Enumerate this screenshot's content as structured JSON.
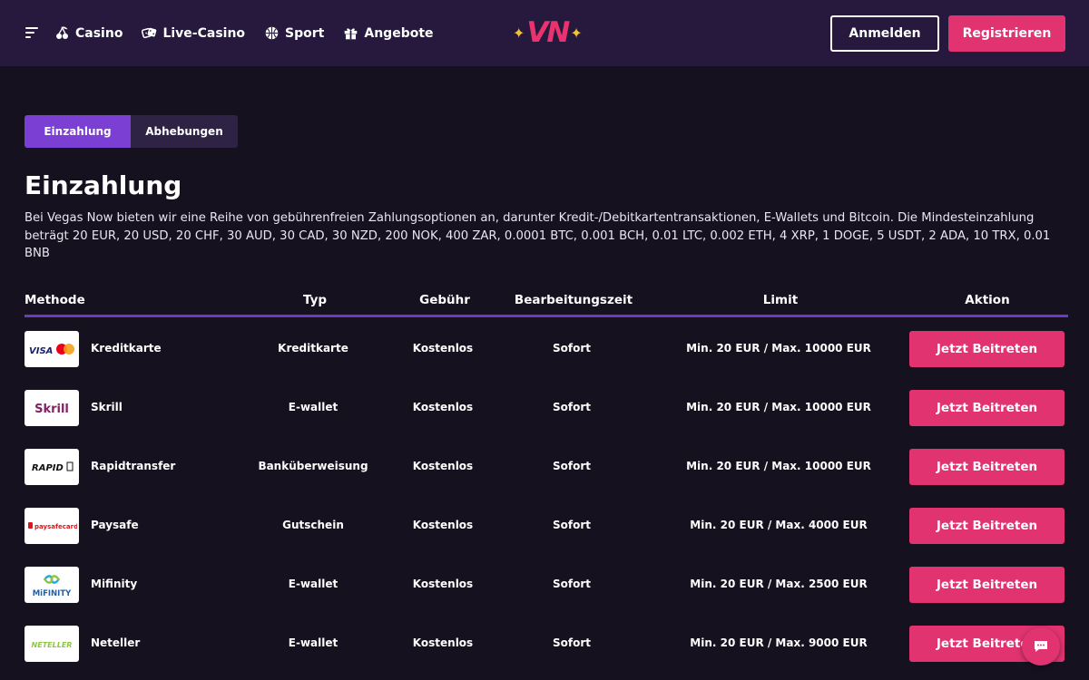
{
  "header": {
    "nav": [
      {
        "label": "Casino",
        "icon": "cherry-icon"
      },
      {
        "label": "Live-Casino",
        "icon": "dice-icon"
      },
      {
        "label": "Sport",
        "icon": "ball-icon"
      },
      {
        "label": "Angebote",
        "icon": "gift-icon"
      }
    ],
    "logo_text": "VN",
    "login_label": "Anmelden",
    "register_label": "Registrieren"
  },
  "tabs": [
    {
      "label": "Einzahlung",
      "active": true
    },
    {
      "label": "Abhebungen",
      "active": false
    }
  ],
  "section": {
    "title": "Einzahlung",
    "description": "Bei Vegas Now bieten wir eine Reihe von gebührenfreien Zahlungsoptionen an, darunter Kredit-/Debitkartentransaktionen, E-Wallets und Bitcoin. Die Mindesteinzahlung beträgt 20 EUR, 20 USD, 20 CHF, 30 AUD, 30 CAD, 30 NZD, 200 NOK, 400 ZAR, 0.0001 BTC, 0.001 BCH, 0.01 LTC, 0.002 ETH, 4 XRP, 1 DOGE, 5 USDT, 2 ADA, 10 TRX, 0.01 BNB"
  },
  "table": {
    "headers": {
      "method": "Methode",
      "type": "Typ",
      "fee": "Gebühr",
      "time": "Bearbeitungszeit",
      "limit": "Limit",
      "action": "Aktion"
    },
    "rows": [
      {
        "name": "Kreditkarte",
        "type": "Kreditkarte",
        "fee": "Kostenlos",
        "time": "Sofort",
        "limit": "Min. 20 EUR / Max. 10000 EUR",
        "action": "Jetzt Beitreten",
        "logo": "visa-mastercard-logo",
        "logo_text": "VISA"
      },
      {
        "name": "Skrill",
        "type": "E-wallet",
        "fee": "Kostenlos",
        "time": "Sofort",
        "limit": "Min. 20 EUR / Max. 10000 EUR",
        "action": "Jetzt Beitreten",
        "logo": "skrill-logo",
        "logo_text": "Skrill"
      },
      {
        "name": "Rapidtransfer",
        "type": "Banküberweisung",
        "fee": "Kostenlos",
        "time": "Sofort",
        "limit": "Min. 20 EUR / Max. 10000 EUR",
        "action": "Jetzt Beitreten",
        "logo": "rapid-logo",
        "logo_text": "RAPID"
      },
      {
        "name": "Paysafe",
        "type": "Gutschein",
        "fee": "Kostenlos",
        "time": "Sofort",
        "limit": "Min. 20 EUR / Max. 4000 EUR",
        "action": "Jetzt Beitreten",
        "logo": "paysafecard-logo",
        "logo_text": "paysafecard"
      },
      {
        "name": "Mifinity",
        "type": "E-wallet",
        "fee": "Kostenlos",
        "time": "Sofort",
        "limit": "Min. 20 EUR / Max. 2500 EUR",
        "action": "Jetzt Beitreten",
        "logo": "mifinity-logo",
        "logo_text": "MiFINITY"
      },
      {
        "name": "Neteller",
        "type": "E-wallet",
        "fee": "Kostenlos",
        "time": "Sofort",
        "limit": "Min. 20 EUR / Max. 9000 EUR",
        "action": "Jetzt Beitreten",
        "logo": "neteller-logo",
        "logo_text": "NETELLER"
      }
    ]
  },
  "colors": {
    "background": "#15111f",
    "header": "#26193d",
    "accent_pink": "#e0336f",
    "accent_purple": "#7b3fd4",
    "logo_star": "#f3c233"
  }
}
